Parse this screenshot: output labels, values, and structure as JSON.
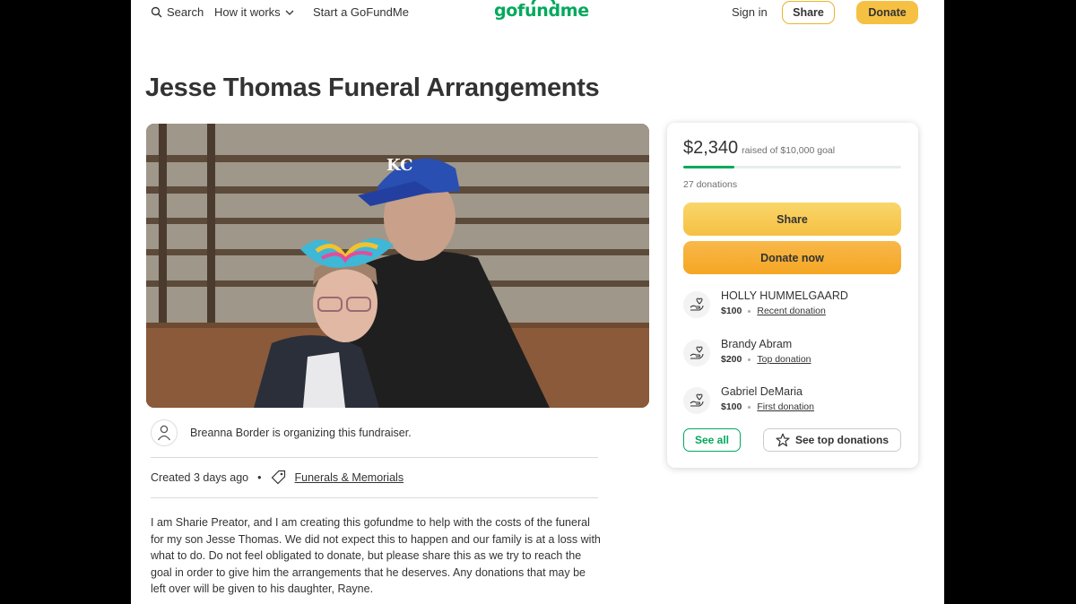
{
  "header": {
    "search_label": "Search",
    "how_it_works_label": "How it works",
    "start_label": "Start a GoFundMe",
    "logo_text": "gofundme",
    "sign_in_label": "Sign in",
    "share_label": "Share",
    "donate_label": "Donate"
  },
  "campaign": {
    "title": "Jesse Thomas Funeral Arrangements",
    "organizer_text": "Breanna Border is organizing this fundraiser.",
    "created": "Created 3 days ago",
    "category": "Funerals & Memorials",
    "story": "I am Sharie Preator, and I am creating this gofundme to help with the costs of the funeral for my son Jesse Thomas. We did not expect this to happen and our family is at a loss with what to do. Do not feel obligated to donate, but please share this as we try to reach the goal in order to give him the arrangements that he deserves. Any donations that may be left over will be given to his daughter, Rayne."
  },
  "donation_card": {
    "raised": "$2,340",
    "goal_text": "raised of $10,000 goal",
    "progress_fraction": 0.234,
    "donations_count": "27 donations",
    "share_label": "Share",
    "donate_now_label": "Donate now",
    "donations": [
      {
        "name": "HOLLY HUMMELGAARD",
        "amount": "$100",
        "tag": "Recent donation"
      },
      {
        "name": "Brandy Abram",
        "amount": "$200",
        "tag": "Top donation"
      },
      {
        "name": "Gabriel DeMaria",
        "amount": "$100",
        "tag": "First donation"
      }
    ],
    "see_all_label": "See all",
    "see_top_label": "See top donations"
  },
  "colors": {
    "brand_green": "#02a95c",
    "accent_yellow": "#f6c043",
    "donate_orange": "#f5a623"
  }
}
